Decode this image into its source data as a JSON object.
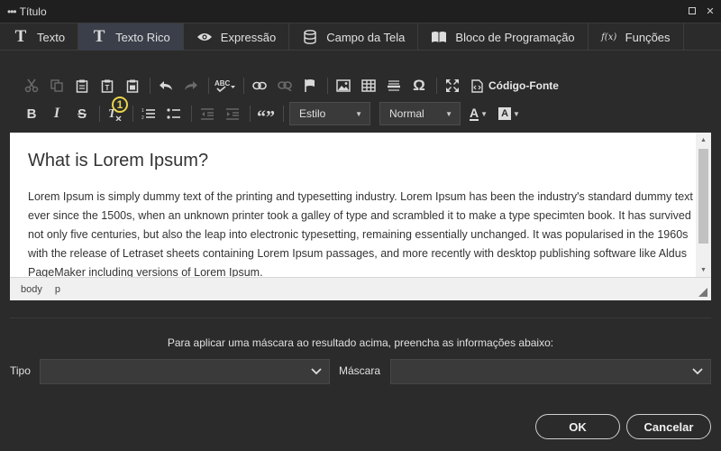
{
  "window": {
    "title": "Título"
  },
  "tabs": [
    {
      "label": "Texto",
      "icon": "text-icon"
    },
    {
      "label": "Texto Rico",
      "icon": "text-icon",
      "active": true
    },
    {
      "label": "Expressão",
      "icon": "eye-icon"
    },
    {
      "label": "Campo da Tela",
      "icon": "database-icon"
    },
    {
      "label": "Bloco de Programação",
      "icon": "book-icon"
    },
    {
      "label": "Funções",
      "icon": "function-icon"
    }
  ],
  "toolbar": {
    "source_label": "Código-Fonte",
    "style_dropdown": "Estilo",
    "format_dropdown": "Normal",
    "badge_number": "1"
  },
  "editor": {
    "heading": "What is Lorem Ipsum?",
    "paragraph": "Lorem Ipsum is simply dummy text of the printing and typesetting industry. Lorem Ipsum has been the industry's standard dummy text ever since the 1500s, when an unknown printer took a galley of type and scrambled it to make a type specimten book. It has survived not only five centuries, but also the leap into electronic typesetting, remaining essentially unchanged. It was popularised in the 1960s with the release of Letraset sheets containing Lorem Ipsum passages, and more recently with desktop publishing software like Aldus PageMaker including versions of Lorem Ipsum."
  },
  "statusbar": {
    "path": [
      "body",
      "p"
    ]
  },
  "mask": {
    "info": "Para aplicar uma máscara ao resultado acima, preencha as informações abaixo:",
    "tipo_label": "Tipo",
    "tipo_value": "",
    "mascara_label": "Máscara",
    "mascara_value": ""
  },
  "buttons": {
    "ok": "OK",
    "cancel": "Cancelar"
  }
}
